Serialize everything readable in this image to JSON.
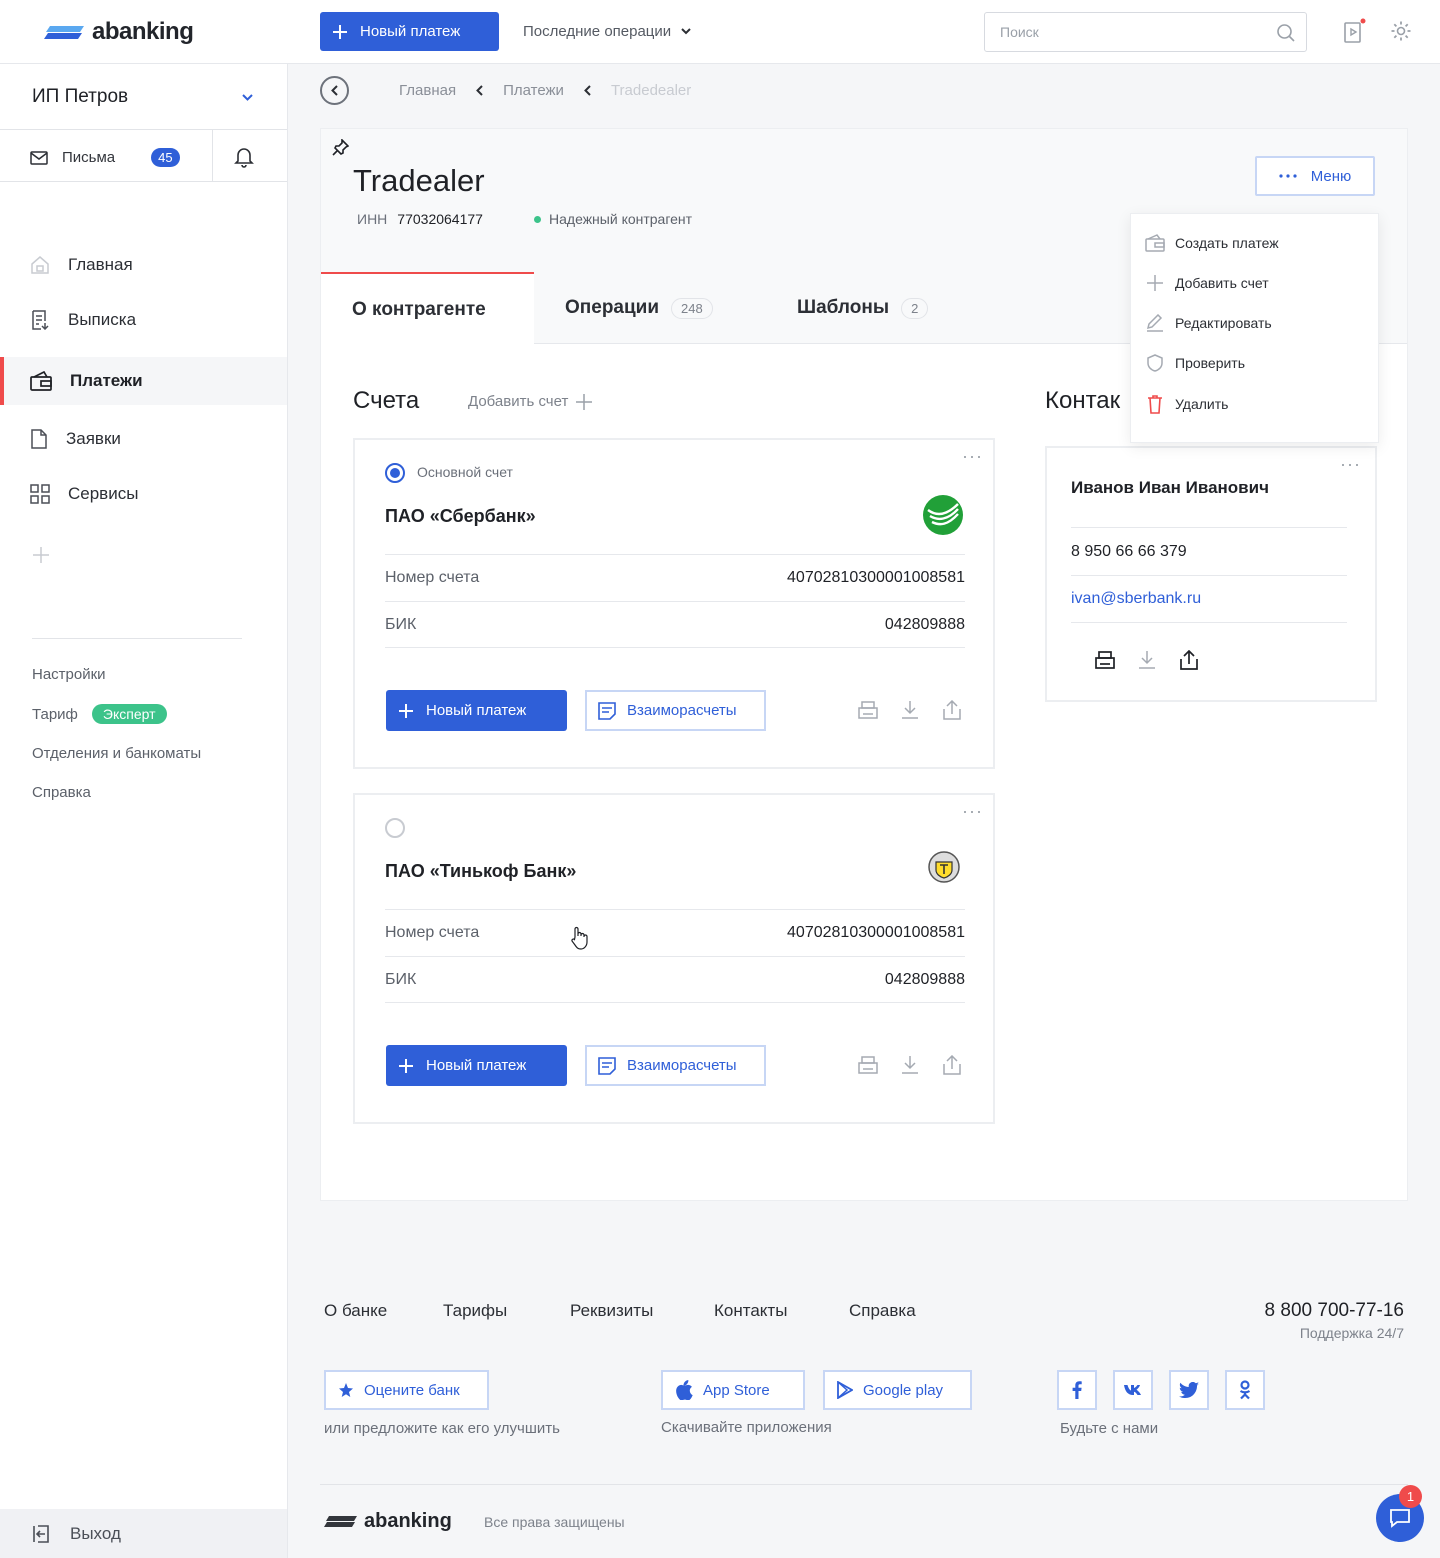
{
  "header": {
    "logo_text": "abanking",
    "new_payment_label": "Новый платеж",
    "recent_ops_label": "Последние операции",
    "search_placeholder": "Поиск"
  },
  "sidebar": {
    "org_name": "ИП Петров",
    "letters_label": "Письма",
    "letters_count": "45",
    "nav": [
      {
        "label": "Главная",
        "icon": "home-icon"
      },
      {
        "label": "Выписка",
        "icon": "statement-icon"
      },
      {
        "label": "Платежи",
        "icon": "wallet-icon",
        "active": true
      },
      {
        "label": "Заявки",
        "icon": "document-icon"
      },
      {
        "label": "Сервисы",
        "icon": "grid-icon"
      }
    ],
    "settings_label": "Настройки",
    "tariff_label": "Тариф",
    "tariff_value": "Эксперт",
    "branches_label": "Отделения и банкоматы",
    "help_label": "Справка",
    "logout_label": "Выход"
  },
  "breadcrumbs": [
    "Главная",
    "Платежи",
    "Tradedealer"
  ],
  "counterparty": {
    "name": "Tradealer",
    "inn_label": "ИНН",
    "inn_value": "77032064177",
    "status": "Надежный контрагент",
    "menu_label": "Меню"
  },
  "tabs": [
    {
      "label": "О контрагенте",
      "active": true
    },
    {
      "label": "Операции",
      "count": "248"
    },
    {
      "label": "Шаблоны",
      "count": "2"
    }
  ],
  "accounts_section": {
    "title": "Счета",
    "add_label": "Добавить счет"
  },
  "accounts": [
    {
      "main_label": "Основной счет",
      "bank": "ПАО «Сбербанк»",
      "account_label": "Номер счета",
      "account_value": "40702810300001008581",
      "bik_label": "БИК",
      "bik_value": "042809888",
      "pay_label": "Новый платеж",
      "settle_label": "Взаиморасчеты"
    },
    {
      "main_label": "",
      "bank": "ПАО «Тинькоф Банк»",
      "account_label": "Номер счета",
      "account_value": "40702810300001008581",
      "bik_label": "БИК",
      "bik_value": "042809888",
      "pay_label": "Новый платеж",
      "settle_label": "Взаиморасчеты"
    }
  ],
  "contacts_section": {
    "title": "Контак"
  },
  "contact": {
    "name": "Иванов Иван Иванович",
    "phone": "8 950 66 66 379",
    "email": "ivan@sberbank.ru"
  },
  "menu_dropdown": [
    {
      "label": "Создать платеж",
      "icon": "wallet-icon"
    },
    {
      "label": "Добавить счет",
      "icon": "plus-icon"
    },
    {
      "label": "Редактировать",
      "icon": "pencil-icon"
    },
    {
      "label": "Проверить",
      "icon": "shield-icon"
    },
    {
      "label": "Удалить",
      "icon": "trash-icon"
    }
  ],
  "footer": {
    "links": [
      "О банке",
      "Тарифы",
      "Реквизиты",
      "Контакты",
      "Справка"
    ],
    "phone": "8 800 700-77-16",
    "support": "Поддержка  24/7",
    "rate_label": "Оцените банк",
    "rate_caption": "или предложите как его улучшить",
    "appstore_label": "App Store",
    "googleplay_label": "Google play",
    "apps_caption": "Скачивайте приложения",
    "social_caption": "Будьте с нами",
    "logo_text": "abanking",
    "rights": "Все права защищены",
    "chat_badge": "1"
  },
  "colors": {
    "accent": "#2f5fd8",
    "active_marker": "#ef4b4b",
    "success": "#3cc38a"
  }
}
